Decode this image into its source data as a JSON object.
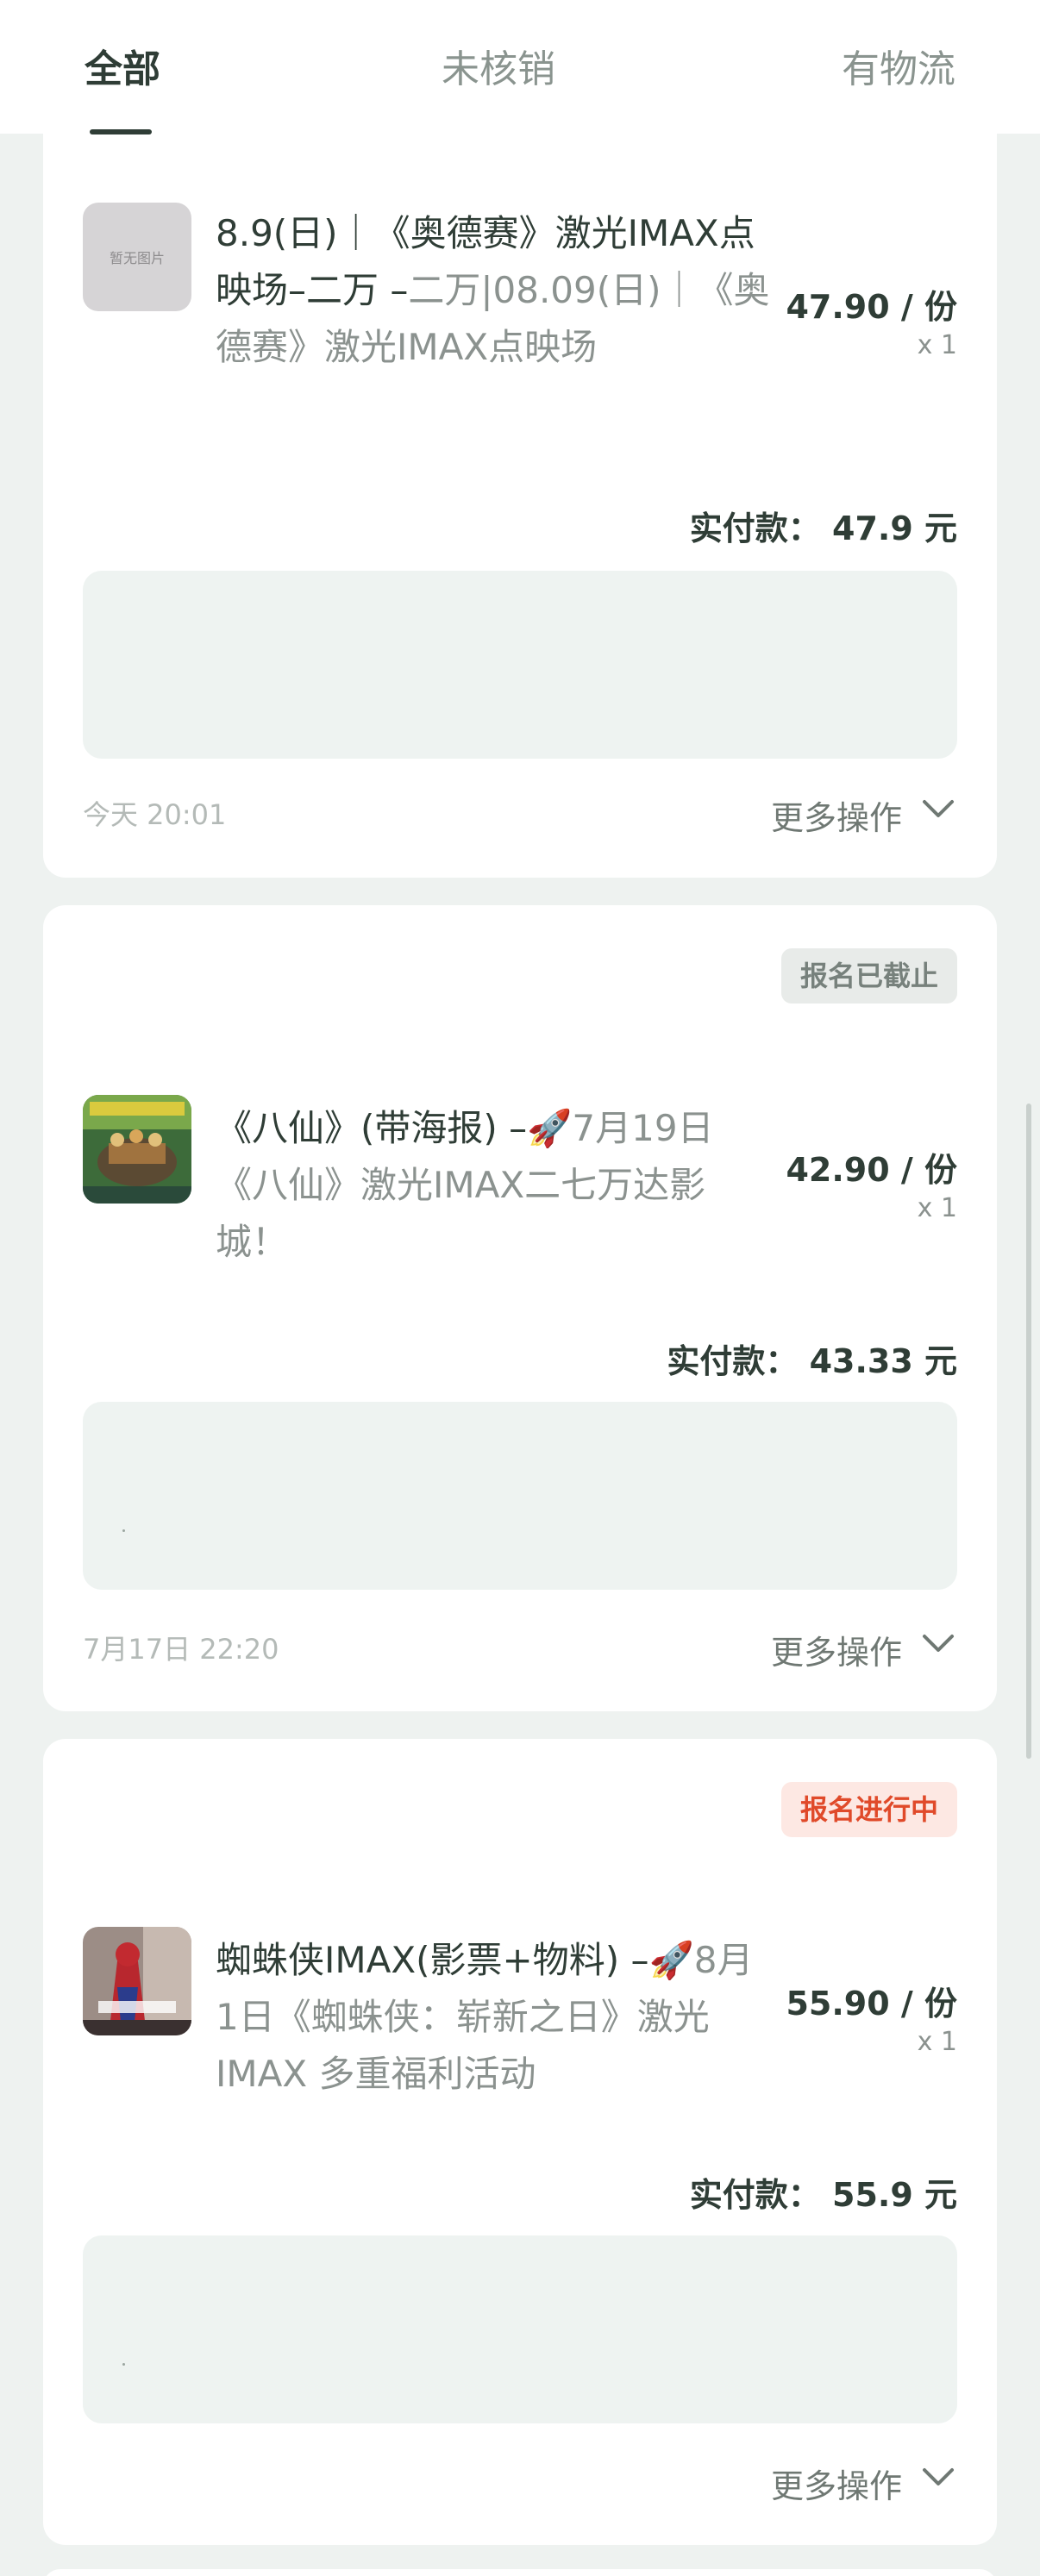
{
  "tabs": [
    {
      "label": "全部",
      "active": true
    },
    {
      "label": "未核销",
      "active": false
    },
    {
      "label": "有物流",
      "active": false
    }
  ],
  "orders": [
    {
      "badge": "",
      "thumbnail": {
        "type": "placeholder",
        "text": "暂无图片"
      },
      "title_strong": "8.9(日)｜《奥德赛》激光IMAX点映场–二万 –",
      "title_rest": "二万|08.09(日)｜《奥德赛》激光IMAX点映场",
      "price": "47.90 / 份",
      "qty": "x 1",
      "paid_label": "实付款：",
      "paid_amount": "47.9 元",
      "time": "今天 20:01",
      "more_label": "更多操作"
    },
    {
      "badge": "报名已截止",
      "badge_state": "closed",
      "thumbnail": {
        "type": "poster",
        "icon": "bahxian-poster-image"
      },
      "title_strong": "《八仙》(带海报) –🚀",
      "title_rest": "7月19日《八仙》激光IMAX二七万达影城！",
      "price": "42.90 / 份",
      "qty": "x 1",
      "paid_label": "实付款：",
      "paid_amount": "43.33 元",
      "time": "7月17日 22:20",
      "more_label": "更多操作"
    },
    {
      "badge": "报名进行中",
      "badge_state": "active",
      "thumbnail": {
        "type": "poster",
        "icon": "spiderman-poster-image"
      },
      "title_strong": "蜘蛛侠IMAX(影票+物料) –🚀",
      "title_rest": "8月1日《蜘蛛侠：崭新之日》激光IMAX 多重福利活动",
      "price": "55.90 / 份",
      "qty": "x 1",
      "paid_label": "实付款：",
      "paid_amount": "55.9 元",
      "time": "",
      "more_label": "更多操作"
    }
  ],
  "colors": {
    "background": "#eef2f0",
    "card": "#ffffff",
    "primary_text": "#2f3d36",
    "muted_text": "#8b928f",
    "badge_active": "#e04a2a",
    "badge_closed": "#77817c"
  }
}
